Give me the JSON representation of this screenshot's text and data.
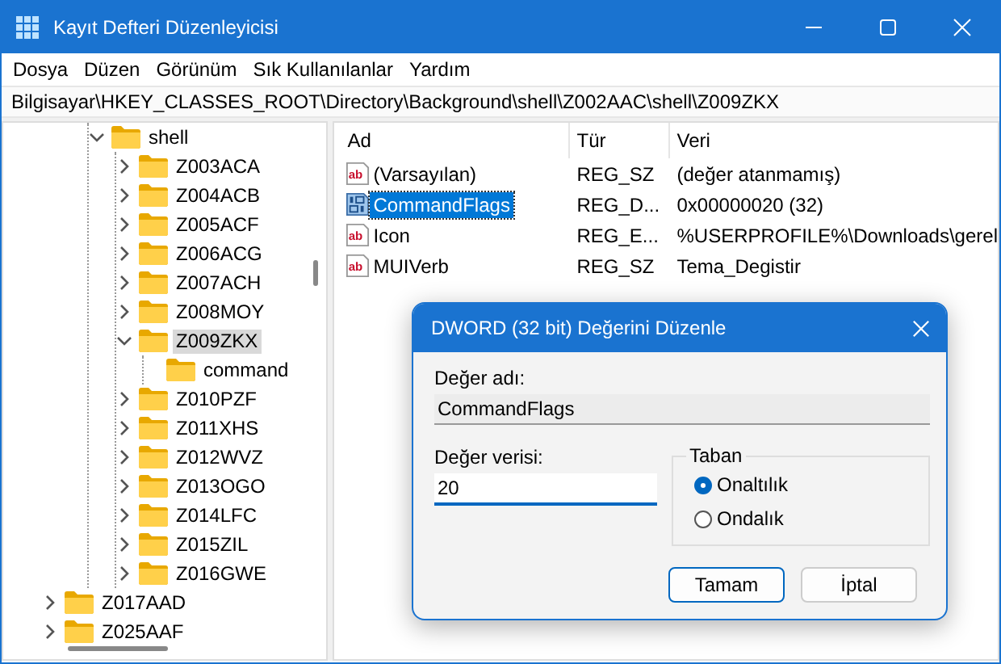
{
  "window": {
    "title": "Kayıt Defteri Düzenleyicisi"
  },
  "menu": [
    "Dosya",
    "Düzen",
    "Görünüm",
    "Sık Kullanılanlar",
    "Yardım"
  ],
  "address": "Bilgisayar\\HKEY_CLASSES_ROOT\\Directory\\Background\\shell\\Z002AAC\\shell\\Z009ZKX",
  "tree": [
    {
      "children": [
        {
          "label": "shell",
          "expanded": true,
          "selected": false,
          "children": [
            {
              "label": "Z003ACA",
              "expanded": false,
              "selected": false
            },
            {
              "label": "Z004ACB",
              "expanded": false,
              "selected": false
            },
            {
              "label": "Z005ACF",
              "expanded": false,
              "selected": false
            },
            {
              "label": "Z006ACG",
              "expanded": false,
              "selected": false
            },
            {
              "label": "Z007ACH",
              "expanded": false,
              "selected": false
            },
            {
              "label": "Z008MOY",
              "expanded": false,
              "selected": false
            },
            {
              "label": "Z009ZKX",
              "expanded": true,
              "selected": true,
              "children": [
                {
                  "label": "command",
                  "selected": false
                }
              ]
            },
            {
              "label": "Z010PZF",
              "expanded": false,
              "selected": false
            },
            {
              "label": "Z011XHS",
              "expanded": false,
              "selected": false
            },
            {
              "label": "Z012WVZ",
              "expanded": false,
              "selected": false
            },
            {
              "label": "Z013OGO",
              "expanded": false,
              "selected": false
            },
            {
              "label": "Z014LFC",
              "expanded": false,
              "selected": false
            },
            {
              "label": "Z015ZIL",
              "expanded": false,
              "selected": false
            },
            {
              "label": "Z016GWE",
              "expanded": false,
              "selected": false
            }
          ]
        }
      ]
    },
    {
      "label": "Z017AAD",
      "expanded": false,
      "selected": false
    },
    {
      "label": "Z025AAF",
      "expanded": false,
      "selected": false
    }
  ],
  "values": {
    "columns": [
      "Ad",
      "Tür",
      "Veri"
    ],
    "rows": [
      {
        "kind": "string",
        "icon_label": "ab",
        "name": "(Varsayılan)",
        "type": "REG_SZ",
        "data": "(değer atanmamış)",
        "selected": false
      },
      {
        "kind": "binary",
        "name": "CommandFlags",
        "type": "REG_D...",
        "data": "0x00000020 (32)",
        "selected": true
      },
      {
        "kind": "string",
        "icon_label": "ab",
        "name": "Icon",
        "type": "REG_E...",
        "data": "%USERPROFILE%\\Downloads\\gerel",
        "selected": false
      },
      {
        "kind": "string",
        "icon_label": "ab",
        "name": "MUIVerb",
        "type": "REG_SZ",
        "data": "Tema_Degistir",
        "selected": false
      }
    ]
  },
  "dialog": {
    "title": "DWORD (32 bit) Değerini Düzenle",
    "name_label": "Değer adı:",
    "name_value": "CommandFlags",
    "data_label": "Değer verisi:",
    "data_value": "20",
    "base_label": "Taban",
    "bases": [
      {
        "label": "Onaltılık",
        "selected": true
      },
      {
        "label": "Ondalık",
        "selected": false
      }
    ],
    "buttons": [
      {
        "label": "Tamam",
        "default": true
      },
      {
        "label": "İptal",
        "default": false
      }
    ]
  }
}
